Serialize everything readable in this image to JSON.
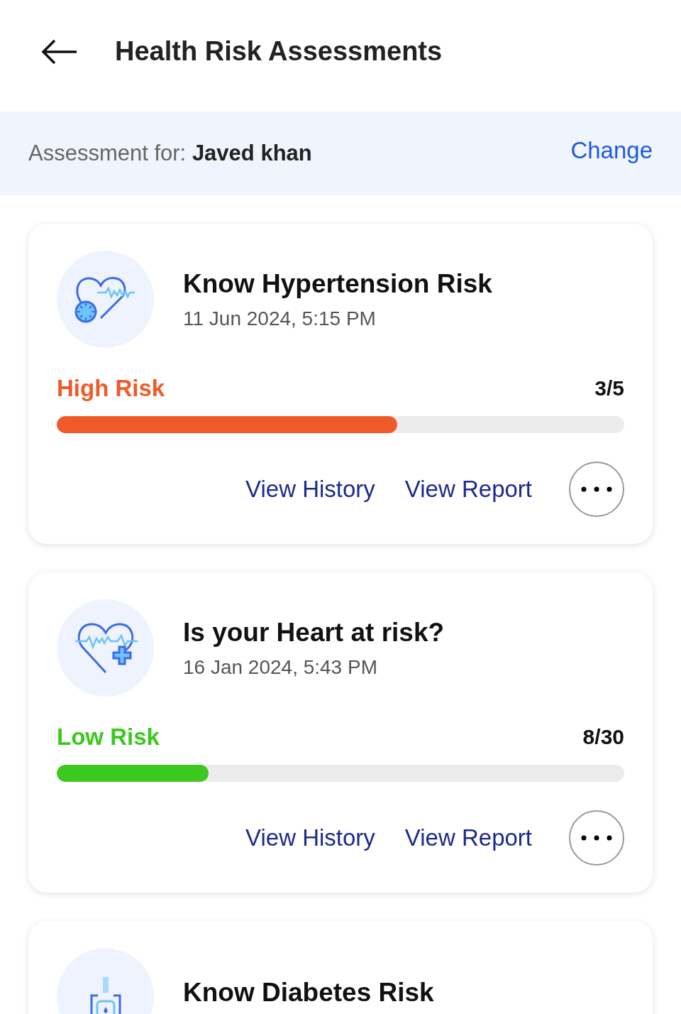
{
  "header": {
    "title": "Health Risk Assessments"
  },
  "assessment_for": {
    "label": "Assessment for:",
    "name": "Javed khan",
    "action": "Change"
  },
  "cards": [
    {
      "kind": "pressure",
      "title": "Know Hypertension Risk",
      "date": "11 Jun 2024, 5:15 PM",
      "risk": {
        "label": "High Risk",
        "color": "#f05a28",
        "score": "3/5",
        "level": 0.6
      },
      "actions": [
        "View History",
        "View Report"
      ]
    },
    {
      "kind": "heart",
      "title": "Is your Heart at risk?",
      "date": "16 Jan 2024, 5:43 PM",
      "risk": {
        "label": "Low Risk",
        "color": "#3cc81e",
        "score": "8/30",
        "level": 0.267
      },
      "actions": [
        "View History",
        "View Report"
      ]
    },
    {
      "kind": "glucose",
      "title": "Know Diabetes Risk"
    }
  ]
}
